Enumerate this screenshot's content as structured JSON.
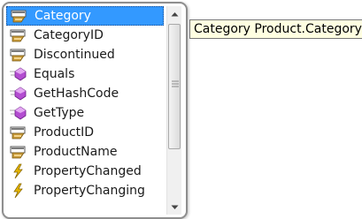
{
  "completion_list": {
    "items": [
      {
        "label": "Category",
        "icon": "property-icon",
        "selected": true
      },
      {
        "label": "CategoryID",
        "icon": "property-icon",
        "selected": false
      },
      {
        "label": "Discontinued",
        "icon": "property-icon",
        "selected": false
      },
      {
        "label": "Equals",
        "icon": "method-icon",
        "selected": false
      },
      {
        "label": "GetHashCode",
        "icon": "method-icon",
        "selected": false
      },
      {
        "label": "GetType",
        "icon": "method-icon",
        "selected": false
      },
      {
        "label": "ProductID",
        "icon": "property-icon",
        "selected": false
      },
      {
        "label": "ProductName",
        "icon": "property-icon",
        "selected": false
      },
      {
        "label": "PropertyChanged",
        "icon": "event-icon",
        "selected": false
      },
      {
        "label": "PropertyChanging",
        "icon": "event-icon",
        "selected": false
      }
    ],
    "scrollbar": {
      "up_icon": "scroll-up-arrow-icon",
      "down_icon": "scroll-down-arrow-icon"
    }
  },
  "tooltip": {
    "text": "Category Product.Category"
  },
  "colors": {
    "selection": "#3399ff",
    "tooltip_bg": "#ffffe1",
    "method_purple": "#b34dd1",
    "event_yellow": "#e8b800"
  }
}
